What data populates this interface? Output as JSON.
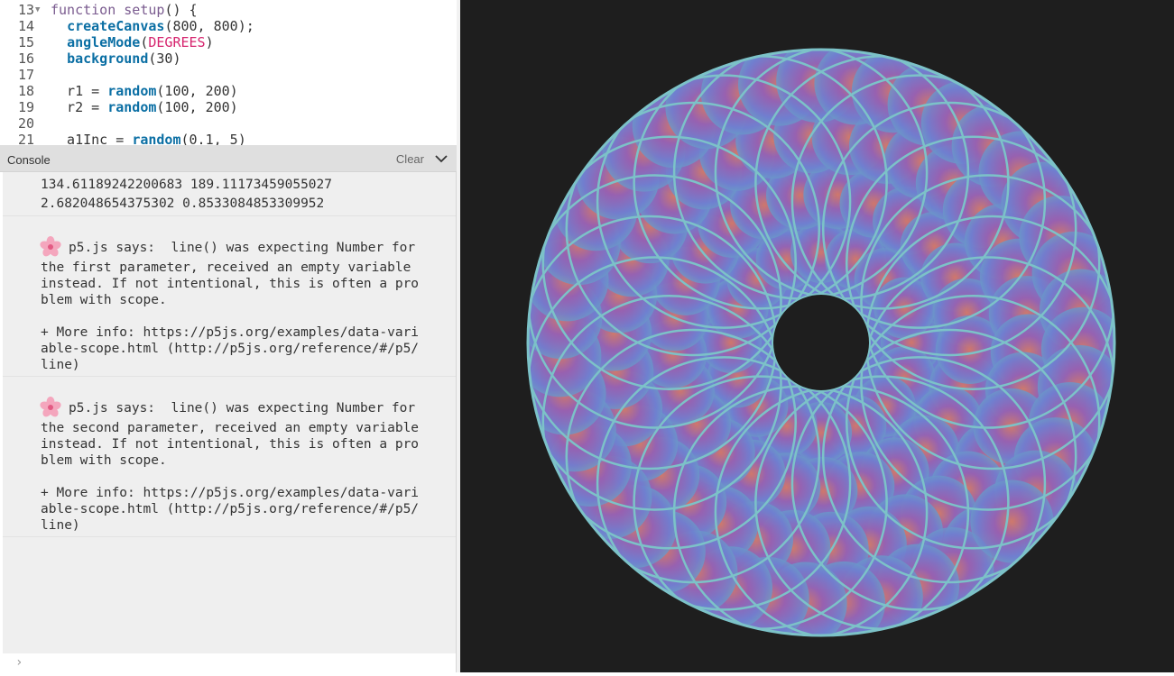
{
  "editor": {
    "lines": [
      {
        "num": "13",
        "fold": "▼",
        "parts": [
          {
            "t": "function ",
            "c": "kw"
          },
          {
            "t": "setup",
            "c": "kw"
          },
          {
            "t": "() {",
            "c": "plain"
          }
        ]
      },
      {
        "num": "14",
        "parts": [
          {
            "t": "  ",
            "c": "plain"
          },
          {
            "t": "createCanvas",
            "c": "fn"
          },
          {
            "t": "(800, 800);",
            "c": "plain"
          }
        ]
      },
      {
        "num": "15",
        "parts": [
          {
            "t": "  ",
            "c": "plain"
          },
          {
            "t": "angleMode",
            "c": "fn"
          },
          {
            "t": "(",
            "c": "plain"
          },
          {
            "t": "DEGREES",
            "c": "const"
          },
          {
            "t": ")",
            "c": "plain"
          }
        ]
      },
      {
        "num": "16",
        "parts": [
          {
            "t": "  ",
            "c": "plain"
          },
          {
            "t": "background",
            "c": "fn"
          },
          {
            "t": "(30)",
            "c": "plain"
          }
        ]
      },
      {
        "num": "17",
        "parts": []
      },
      {
        "num": "18",
        "parts": [
          {
            "t": "  r1 = ",
            "c": "plain"
          },
          {
            "t": "random",
            "c": "fn"
          },
          {
            "t": "(100, 200)",
            "c": "plain"
          }
        ]
      },
      {
        "num": "19",
        "parts": [
          {
            "t": "  r2 = ",
            "c": "plain"
          },
          {
            "t": "random",
            "c": "fn"
          },
          {
            "t": "(100, 200)",
            "c": "plain"
          }
        ]
      },
      {
        "num": "20",
        "parts": []
      },
      {
        "num": "21",
        "parts": [
          {
            "t": "  a1Inc = ",
            "c": "plain"
          },
          {
            "t": "random",
            "c": "fn"
          },
          {
            "t": "(0.1, 5)",
            "c": "plain"
          }
        ]
      }
    ]
  },
  "console": {
    "title": "Console",
    "clear_label": "Clear",
    "log_lines": [
      "134.61189242200683 189.11173459055027",
      "2.682048654375302 0.8533084853309952"
    ],
    "warnings": [
      {
        "lines": [
          "p5.js says:  line() was expecting Number for",
          "the first parameter, received an empty variable",
          "instead. If not intentional, this is often a pro",
          "blem with scope.",
          "",
          "+ More info: https://p5js.org/examples/data-vari",
          "able-scope.html (http://p5js.org/reference/#/p5/",
          "line)"
        ]
      },
      {
        "lines": [
          "p5.js says:  line() was expecting Number for",
          "the second parameter, received an empty variable",
          "instead. If not intentional, this is often a pro",
          "blem with scope.",
          "",
          "+ More info: https://p5js.org/examples/data-vari",
          "able-scope.html (http://p5js.org/reference/#/p5/",
          "line)"
        ]
      }
    ],
    "prompt": "›"
  },
  "canvas": {
    "background": "#1e1e1e",
    "colors": {
      "teal": "#66b3c0",
      "blue": "#6f7fd0",
      "purple": "#9a5fae",
      "orange": "#e0765a"
    }
  }
}
